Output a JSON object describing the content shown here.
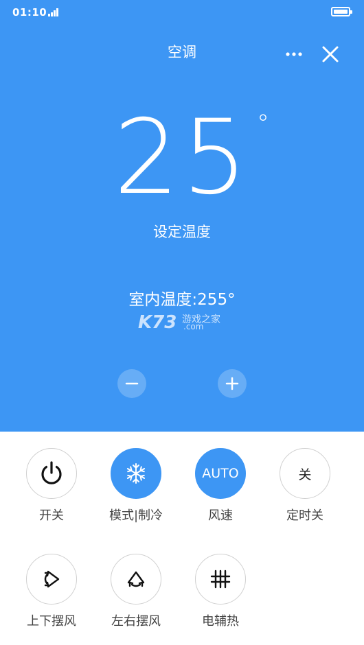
{
  "status": {
    "time": "01:10"
  },
  "header": {
    "title": "空调"
  },
  "temperature": {
    "value": "25",
    "unit": "°",
    "label": "设定温度"
  },
  "indoor": {
    "text": "室内温度:255°"
  },
  "watermark": {
    "brand": "K73",
    "tagline": "游戏之家",
    "domain": ".com"
  },
  "controls": [
    {
      "label": "开关",
      "icon": "power-icon",
      "active": false
    },
    {
      "label": "模式|制冷",
      "icon": "snowflake-icon",
      "active": true
    },
    {
      "label": "风速",
      "text": "AUTO",
      "active": true
    },
    {
      "label": "定时关",
      "text": "关",
      "active": false
    },
    {
      "label": "上下摆风",
      "icon": "vertical-swing-icon",
      "active": false
    },
    {
      "label": "左右摆风",
      "icon": "horizontal-swing-icon",
      "active": false
    },
    {
      "label": "电辅热",
      "icon": "heater-grid-icon",
      "active": false
    }
  ],
  "colors": {
    "primary": "#3d96f4",
    "white": "#ffffff",
    "border": "#d0d0d0",
    "label": "#444444"
  }
}
